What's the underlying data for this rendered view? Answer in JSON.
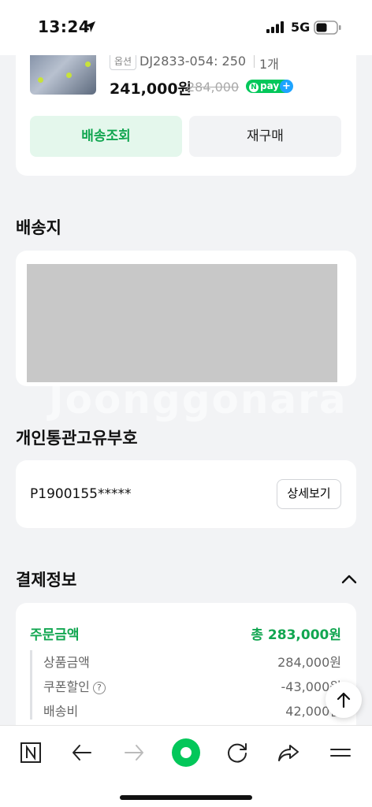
{
  "status_bar": {
    "time": "13:24",
    "network": "5G"
  },
  "product": {
    "option_badge": "옵션",
    "option_text": "DJ2833-054: 250",
    "quantity": "1개",
    "price": "241,000원",
    "original_price": "284,000",
    "npay_label": "pay",
    "npay_n": "N",
    "npay_plus": "+",
    "track_button": "배송조회",
    "rebuy_button": "재구매"
  },
  "shipping": {
    "title": "배송지"
  },
  "watermark": "Joonggonara",
  "customs": {
    "title": "개인통관고유부호",
    "number": "P1900155*****",
    "detail_button": "상세보기"
  },
  "payment": {
    "title": "결제정보",
    "order_total_label": "주문금액",
    "order_total_value": "총 283,000원",
    "rows": [
      {
        "label": "상품금액",
        "value": "284,000원"
      },
      {
        "label": "쿠폰할인",
        "value": "-43,000원",
        "help": "?"
      },
      {
        "label": "배송비",
        "value": "42,000원"
      }
    ]
  },
  "colors": {
    "accent_green": "#11a650",
    "npay_green": "#03c75a",
    "background": "#f2f3f5"
  }
}
